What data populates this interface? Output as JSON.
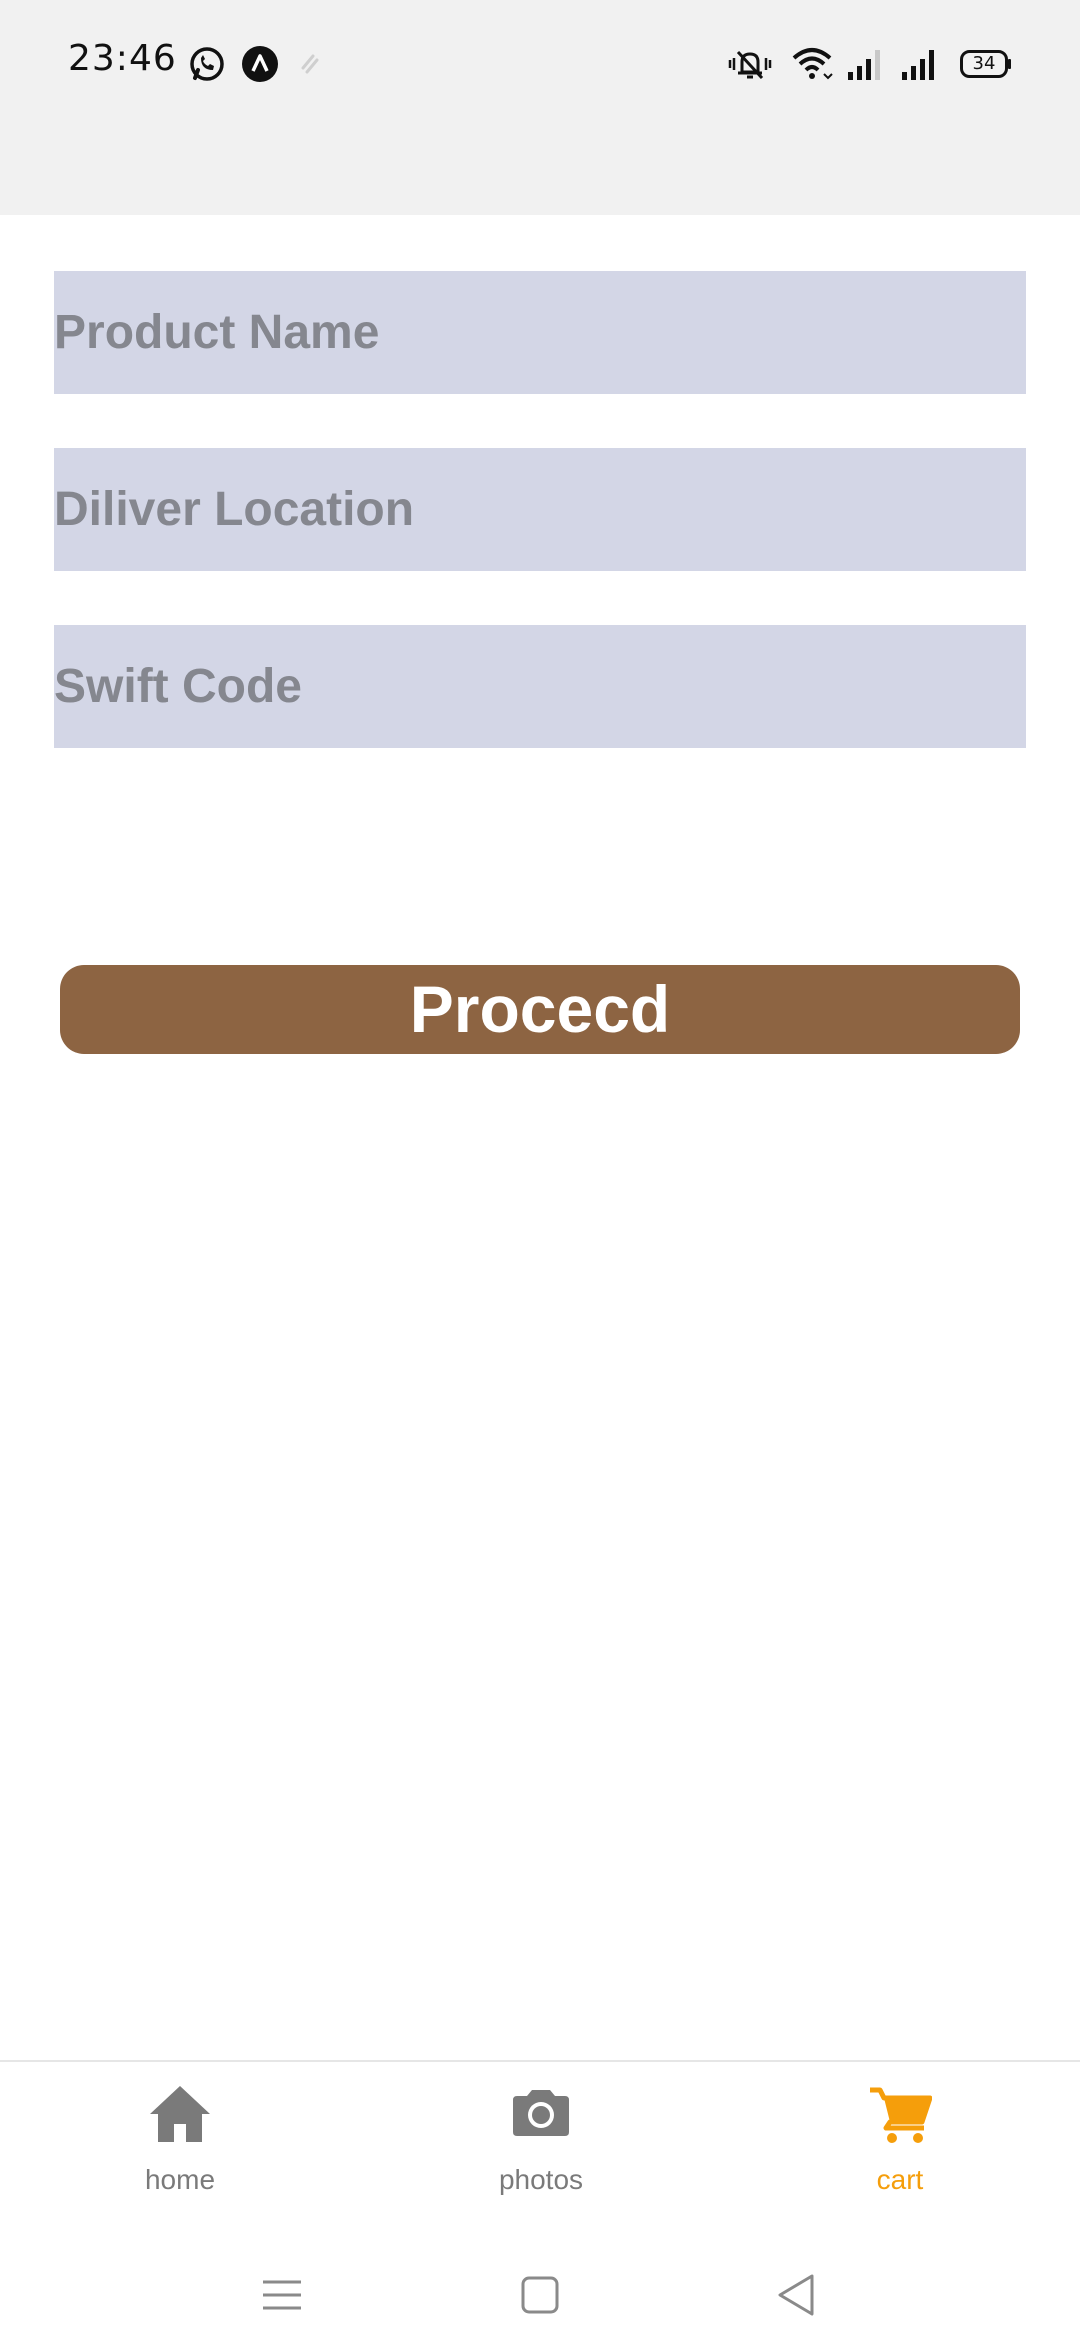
{
  "status_bar": {
    "time": "23:46",
    "battery": "34",
    "icons": [
      "whatsapp-icon",
      "app-icon",
      "sync-icon",
      "mute-icon",
      "wifi-icon",
      "signal-icon",
      "signal-icon",
      "battery-icon"
    ]
  },
  "form": {
    "product_name_placeholder": "Product Name",
    "location_placeholder": "Diliver Location",
    "swift_code_placeholder": "Swift Code",
    "field_bg_color": "#d3d6e6"
  },
  "proceed_button": {
    "label": "Procecd",
    "color": "#8d6442"
  },
  "tabs": [
    {
      "label": "home",
      "icon": "home-icon",
      "active": false
    },
    {
      "label": "photos",
      "icon": "camera-icon",
      "active": false
    },
    {
      "label": "cart",
      "icon": "cart-icon",
      "active": true
    }
  ],
  "colors": {
    "active_tab": "#f59e0b",
    "inactive_tab": "#7a7a7a"
  }
}
